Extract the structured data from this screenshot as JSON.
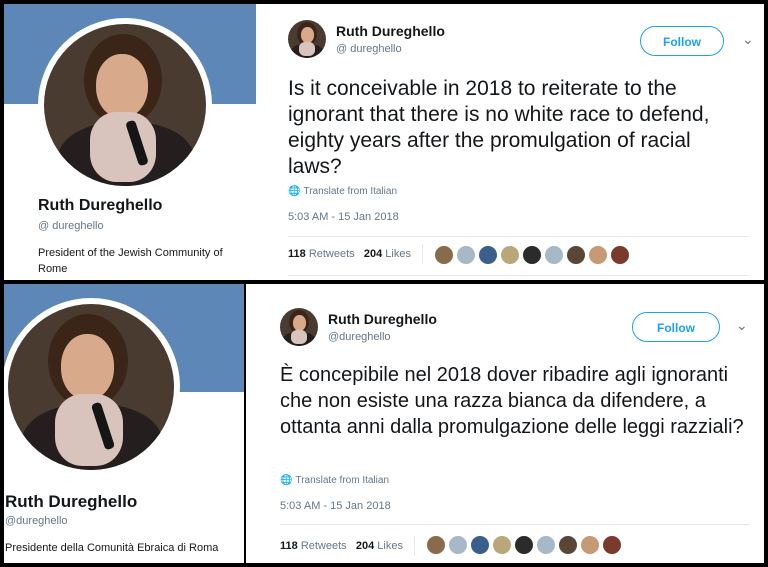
{
  "top": {
    "profile": {
      "name": "Ruth Dureghello",
      "handle": "@ dureghello",
      "bio": "President of the Jewish Community of Rome"
    },
    "tweet": {
      "name": "Ruth Dureghello",
      "handle": "@ dureghello",
      "follow_label": "Follow",
      "text": "Is it conceivable in 2018 to reiterate to the ignorant that there is no white race to defend, eighty years after the promulgation of racial laws?",
      "translate": "Translate from Italian",
      "time": "5:03 AM - 15 Jan 2018",
      "retweets": "118",
      "retweets_label": "Retweets",
      "likes": "204",
      "likes_label": "Likes"
    }
  },
  "bottom": {
    "profile": {
      "name": "Ruth Dureghello",
      "handle": "@dureghello",
      "bio": "Presidente della Comunità Ebraica di Roma"
    },
    "tweet": {
      "name": "Ruth Dureghello",
      "handle": "@dureghello",
      "follow_label": "Follow",
      "text": "È concepibile nel 2018 dover ribadire agli ignoranti che non esiste una razza bianca da difendere, a ottanta anni dalla promulgazione delle leggi razziali?",
      "translate": "Translate from Italian",
      "time": "5:03 AM - 15 Jan 2018",
      "retweets": "118",
      "retweets_label": "Retweets",
      "likes": "204",
      "likes_label": "Likes"
    }
  },
  "likers_colors": [
    "#8a6a4a",
    "#a7b8c6",
    "#3a5f8c",
    "#b9a77a",
    "#2b2b2b",
    "#a7b8c6",
    "#5a4636",
    "#c79a76",
    "#7a3b2b"
  ],
  "colors": {
    "accent": "#1da1f2",
    "cover": "#5c87b6"
  }
}
